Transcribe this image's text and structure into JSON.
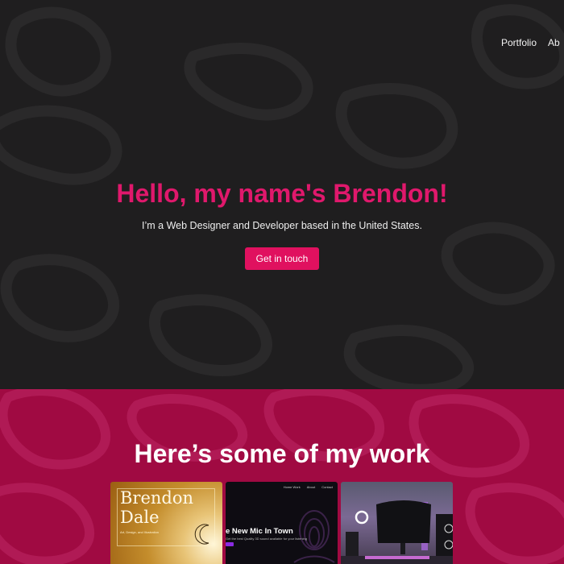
{
  "nav": {
    "items": [
      "Portfolio",
      "Ab"
    ]
  },
  "hero": {
    "title": "Hello, my name's Brendon!",
    "subtitle": "I’m a Web Designer and Developer based in the United States.",
    "cta": "Get in touch"
  },
  "work": {
    "title": "Here’s some of my work",
    "card1": {
      "name_line1": "Brendon",
      "name_line2": "Dale",
      "tagline": "Art, Design, and Illustration"
    },
    "card2": {
      "nav": [
        "Home Work",
        "About",
        "Contact"
      ],
      "title": "e New Mic In Town",
      "subtitle": "Get the best Quality 3D sound available for your listening"
    }
  },
  "colors": {
    "accent": "#e0186c",
    "hero_bg": "#1f1e1f",
    "work_bg": "#a00a42"
  }
}
